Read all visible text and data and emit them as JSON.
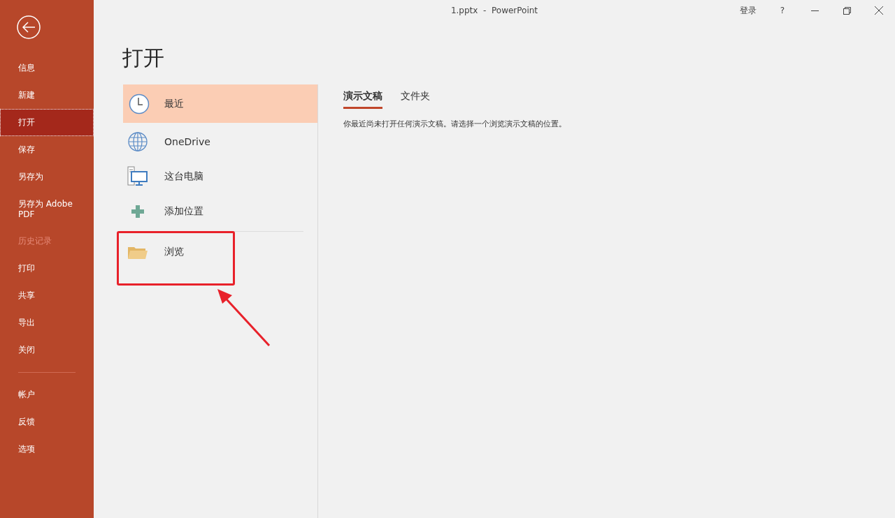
{
  "window": {
    "title": "1.pptx  -  PowerPoint",
    "sign_in": "登录",
    "help": "?"
  },
  "sidebar": {
    "items": [
      {
        "label": "信息",
        "selected": false,
        "disabled": false
      },
      {
        "label": "新建",
        "selected": false,
        "disabled": false
      },
      {
        "label": "打开",
        "selected": true,
        "disabled": false
      },
      {
        "label": "保存",
        "selected": false,
        "disabled": false
      },
      {
        "label": "另存为",
        "selected": false,
        "disabled": false
      },
      {
        "label": "另存为 Adobe PDF",
        "selected": false,
        "disabled": false
      },
      {
        "label": "历史记录",
        "selected": false,
        "disabled": true
      },
      {
        "label": "打印",
        "selected": false,
        "disabled": false
      },
      {
        "label": "共享",
        "selected": false,
        "disabled": false
      },
      {
        "label": "导出",
        "selected": false,
        "disabled": false
      },
      {
        "label": "关闭",
        "selected": false,
        "disabled": false
      }
    ],
    "lower_items": [
      {
        "label": "帐户",
        "selected": false,
        "disabled": false
      },
      {
        "label": "反馈",
        "selected": false,
        "disabled": false
      },
      {
        "label": "选项",
        "selected": false,
        "disabled": false
      }
    ]
  },
  "page_title": "打开",
  "locations": [
    {
      "kind": "clock",
      "label": "最近",
      "selected": true
    },
    {
      "kind": "globe",
      "label": "OneDrive",
      "selected": false
    },
    {
      "kind": "computer",
      "label": "这台电脑",
      "selected": false
    },
    {
      "kind": "plus",
      "label": "添加位置",
      "selected": false
    }
  ],
  "browse": {
    "kind": "folder",
    "label": "浏览"
  },
  "tabs": [
    {
      "label": "演示文稿",
      "selected": true
    },
    {
      "label": "文件夹",
      "selected": false
    }
  ],
  "message": "你最近尚未打开任何演示文稿。请选择一个浏览演示文稿的位置。"
}
